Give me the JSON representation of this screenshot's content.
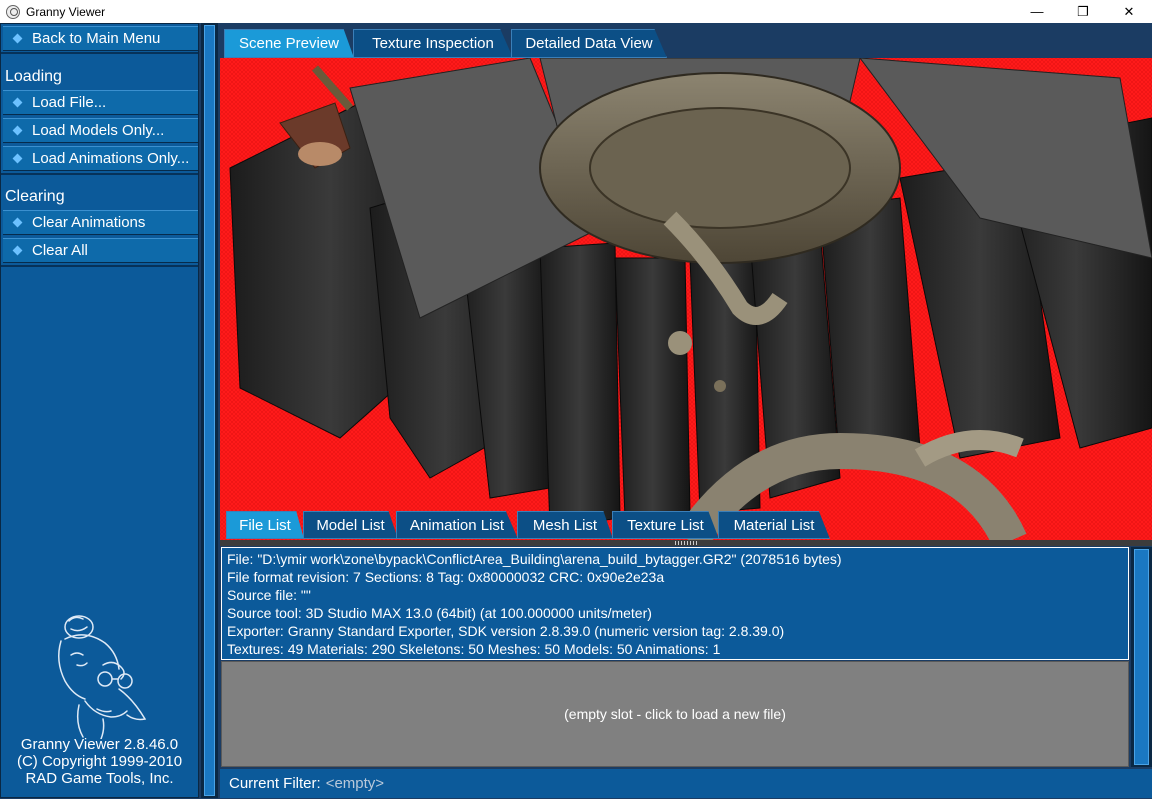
{
  "window": {
    "title": "Granny Viewer",
    "minimize_glyph": "—",
    "restore_glyph": "❐",
    "close_glyph": "✕"
  },
  "sidebar": {
    "back_label": "Back to Main Menu",
    "loading_title": "Loading",
    "loading_items": [
      "Load File...",
      "Load Models Only...",
      "Load Animations Only..."
    ],
    "clearing_title": "Clearing",
    "clearing_items": [
      "Clear Animations",
      "Clear All"
    ],
    "about": {
      "version": "Granny Viewer 2.8.46.0",
      "copyright": "(C) Copyright 1999-2010",
      "company": "RAD Game Tools, Inc."
    }
  },
  "top_tabs": [
    {
      "label": "Scene Preview",
      "active": true
    },
    {
      "label": "Texture Inspection",
      "active": false
    },
    {
      "label": "Detailed Data View",
      "active": false
    }
  ],
  "bottom_tabs": [
    {
      "label": "File List",
      "active": true
    },
    {
      "label": "Model List",
      "active": false
    },
    {
      "label": "Animation List",
      "active": false
    },
    {
      "label": "Mesh List",
      "active": false
    },
    {
      "label": "Texture List",
      "active": false
    },
    {
      "label": "Material List",
      "active": false
    }
  ],
  "file_info": {
    "lines": [
      "File: \"D:\\ymir work\\zone\\bypack\\ConflictArea_Building\\arena_build_bytagger.GR2\" (2078516 bytes)",
      "File format revision: 7     Sections: 8     Tag: 0x80000032     CRC: 0x90e2e23a",
      "Source file: \"\"",
      "Source tool: 3D Studio MAX 13.0 (64bit) (at 100.000000 units/meter)",
      "Exporter: Granny Standard Exporter, SDK version 2.8.39.0 (numeric version tag: 2.8.39.0)",
      "Textures: 49     Materials: 290     Skeletons: 50     Meshes: 50     Models: 50     Animations: 1"
    ],
    "empty_slot": "(empty slot - click to load a new file)"
  },
  "filter": {
    "label": "Current Filter:",
    "value": "<empty>"
  },
  "colors": {
    "viewport_bg": "#ff1a1a",
    "panel_blue": "#0c5a9a",
    "active_tab": "#1b9ad8"
  }
}
